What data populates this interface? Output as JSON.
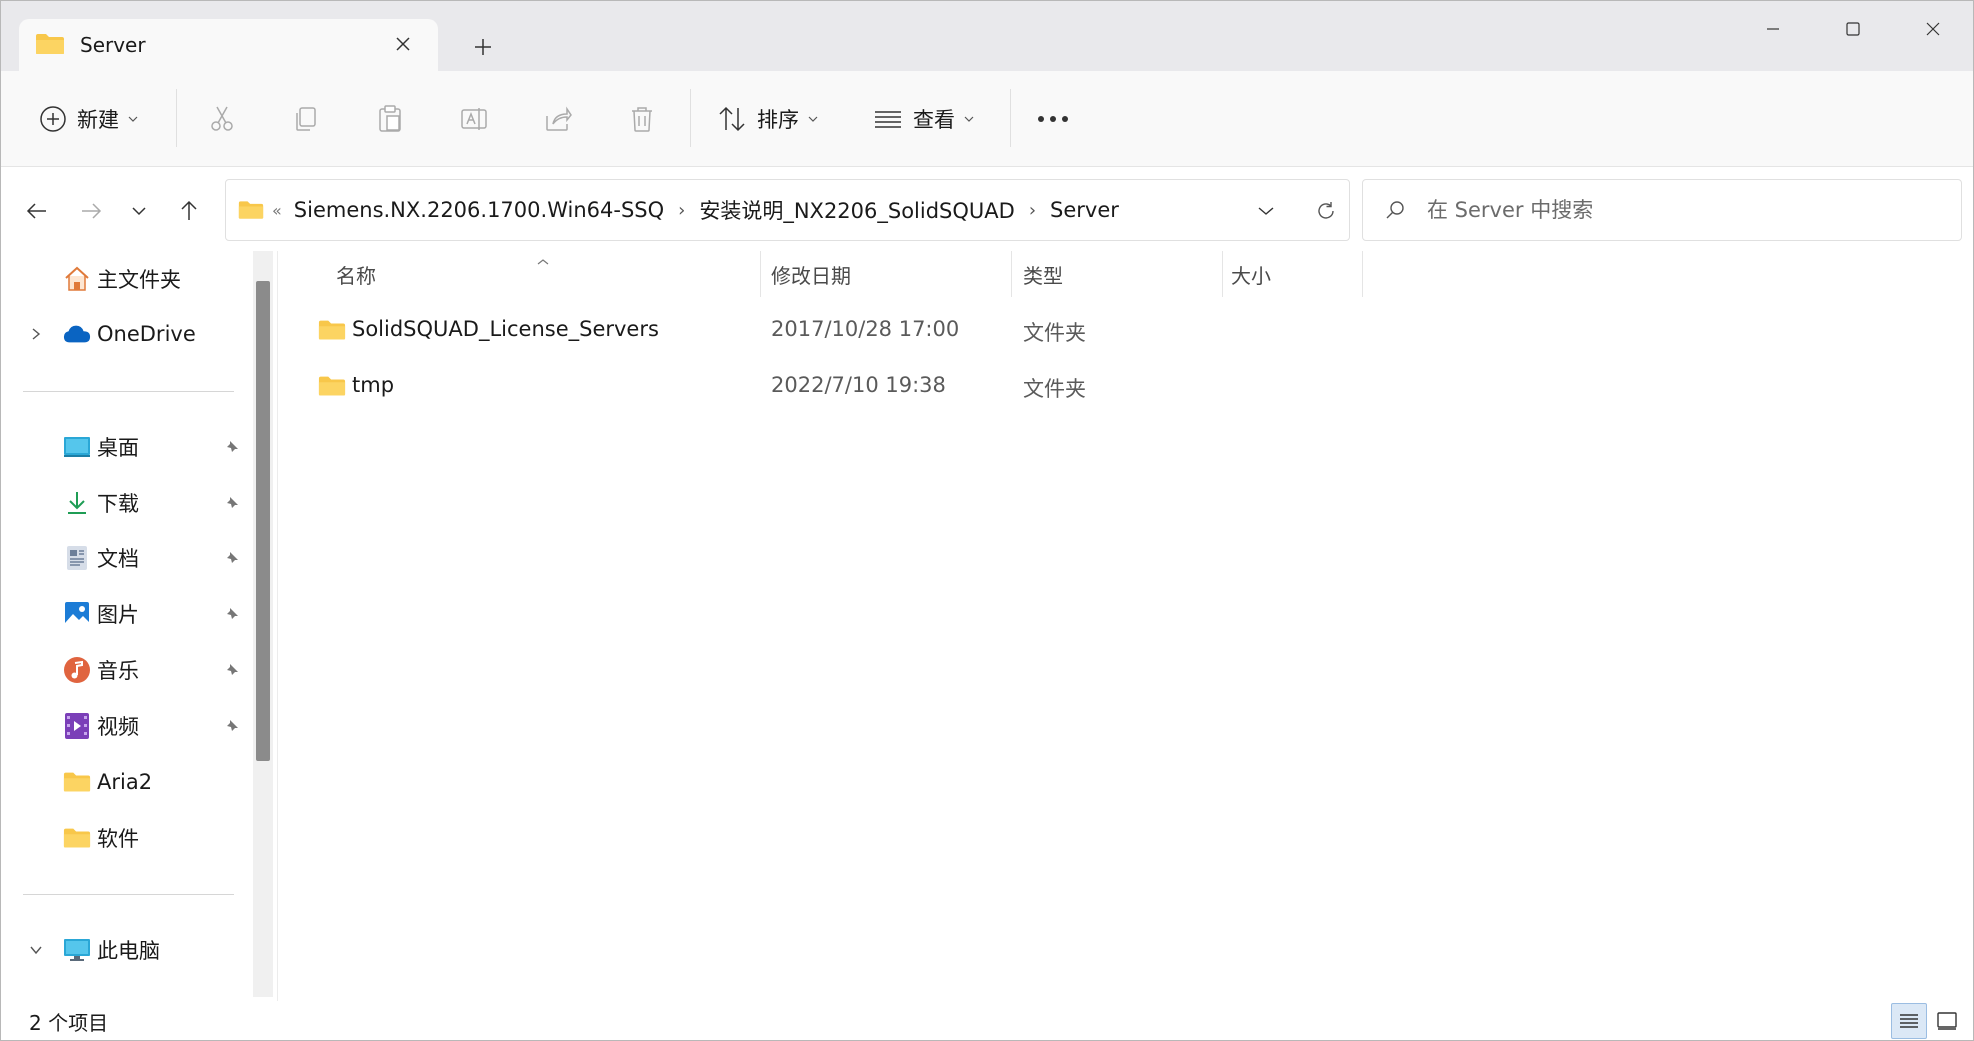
{
  "titlebar": {
    "tab_title": "Server",
    "tab_close_icon": "close-icon",
    "new_tab_icon": "plus-icon"
  },
  "window_controls": [
    "minimize-icon",
    "maximize-icon",
    "close-icon"
  ],
  "toolbar": {
    "new_label": "新建",
    "actions": [
      "cut-icon",
      "copy-icon",
      "paste-icon",
      "rename-icon",
      "share-icon",
      "delete-icon"
    ],
    "sort_label": "排序",
    "view_label": "查看",
    "more_icon": "more-icon"
  },
  "address": {
    "overflow": "«",
    "crumbs": [
      "Siemens.NX.2206.1700.Win64-SSQ",
      "安装说明_NX2206_SolidSQUAD",
      "Server"
    ],
    "separator": "›"
  },
  "search": {
    "placeholder": "在 Server 中搜索"
  },
  "sidebar": {
    "home": "主文件夹",
    "onedrive": "OneDrive",
    "quick_access": [
      {
        "label": "桌面",
        "icon": "desktop-icon",
        "pinned": true
      },
      {
        "label": "下载",
        "icon": "download-icon",
        "pinned": true
      },
      {
        "label": "文档",
        "icon": "documents-icon",
        "pinned": true
      },
      {
        "label": "图片",
        "icon": "pictures-icon",
        "pinned": true
      },
      {
        "label": "音乐",
        "icon": "music-icon",
        "pinned": true
      },
      {
        "label": "视频",
        "icon": "videos-icon",
        "pinned": true
      },
      {
        "label": "Aria2",
        "icon": "folder-icon",
        "pinned": false
      },
      {
        "label": "软件",
        "icon": "folder-icon",
        "pinned": false
      }
    ],
    "this_pc": "此电脑"
  },
  "columns": {
    "name": "名称",
    "modified": "修改日期",
    "type": "类型",
    "size": "大小"
  },
  "files": [
    {
      "name": "SolidSQUAD_License_Servers",
      "modified": "2017/10/28 17:00",
      "type": "文件夹",
      "size": ""
    },
    {
      "name": "tmp",
      "modified": "2022/7/10 19:38",
      "type": "文件夹",
      "size": ""
    }
  ],
  "status": {
    "item_count": "2 个项目"
  },
  "colors": {
    "folder": "#f8c74a",
    "accent": "#0a64c2",
    "window_bg": "#ffffff",
    "titlebar_bg": "#e9e9ec"
  }
}
